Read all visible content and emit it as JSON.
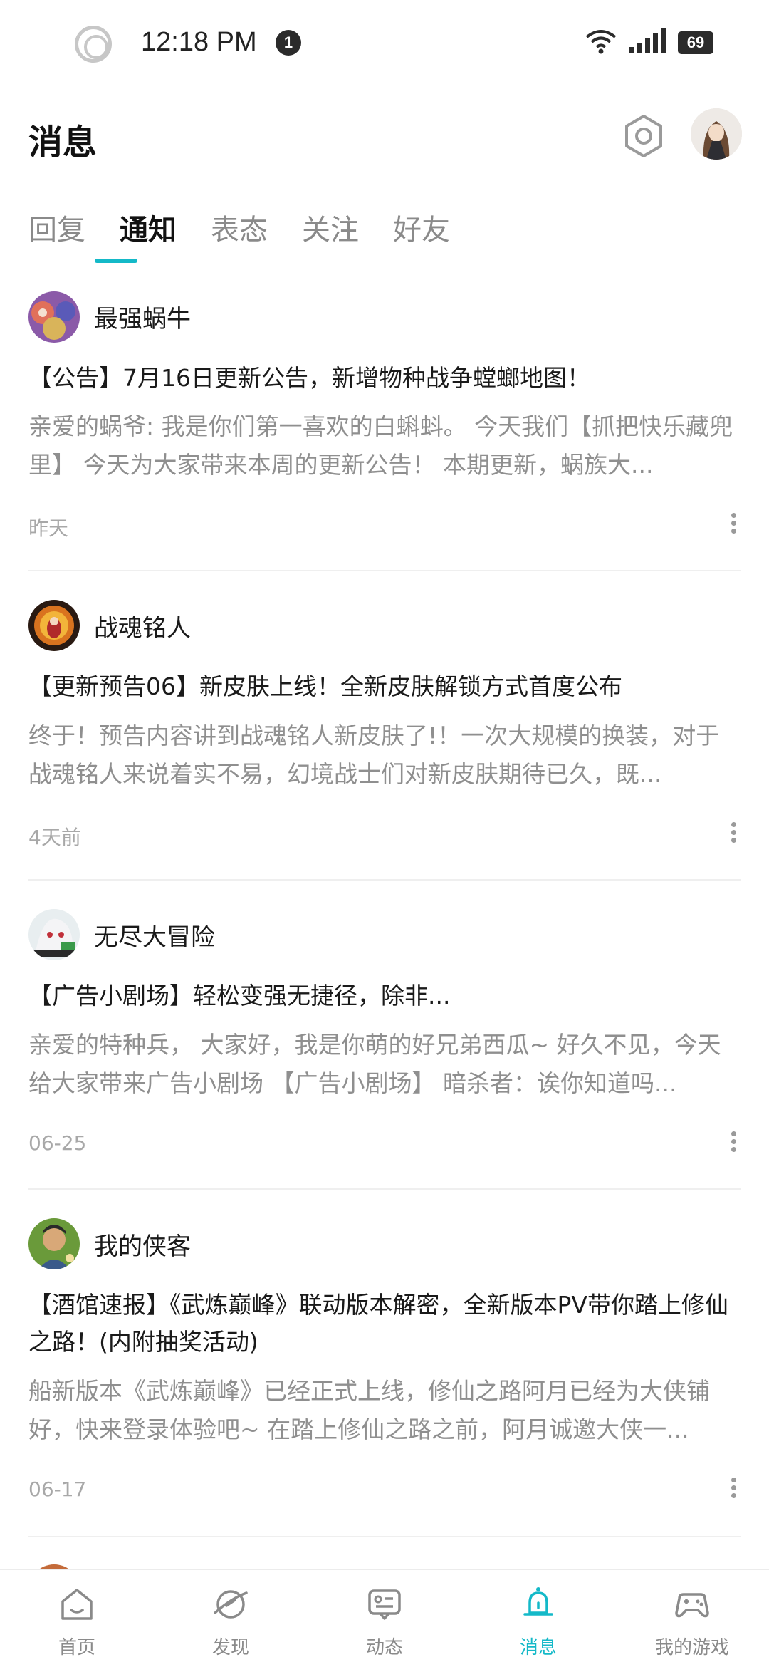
{
  "status_bar": {
    "time": "12:18 PM",
    "notification_count": "1",
    "battery": "69"
  },
  "header": {
    "title": "消息"
  },
  "tabs": [
    {
      "label": "回复"
    },
    {
      "label": "通知"
    },
    {
      "label": "表态"
    },
    {
      "label": "关注"
    },
    {
      "label": "好友"
    }
  ],
  "active_tab": "通知",
  "posts": [
    {
      "author": "最强蜗牛",
      "title": "【公告】7月16日更新公告，新增物种战争螳螂地图！",
      "excerpt": "亲爱的蜗爷: 我是你们第一喜欢的白蝌蚪。 今天我们【抓把快乐藏兜里】 今天为大家带来本周的更新公告！ 本期更新，蜗族大...",
      "time": "昨天"
    },
    {
      "author": "战魂铭人",
      "title": "【更新预告06】新皮肤上线！全新皮肤解锁方式首度公布",
      "excerpt": "终于！预告内容讲到战魂铭人新皮肤了!！一次大规模的换装，对于战魂铭人来说着实不易，幻境战士们对新皮肤期待已久，既...",
      "time": "4天前"
    },
    {
      "author": "无尽大冒险",
      "title": "【广告小剧场】轻松变强无捷径，除非...",
      "excerpt": "亲爱的特种兵， 大家好，我是你萌的好兄弟西瓜~ 好久不见，今天给大家带来广告小剧场 【广告小剧场】 暗杀者：诶你知道吗...",
      "time": "06-25"
    },
    {
      "author": "我的侠客",
      "title": "【酒馆速报】《武炼巅峰》联动版本解密，全新版本PV带你踏上修仙之路！(内附抽奖活动)",
      "excerpt": "船新版本《武炼巅峰》已经正式上线，修仙之路阿月已经为大侠铺好，快来登录体验吧~ 在踏上修仙之路之前，阿月诚邀大侠一...",
      "time": "06-17"
    }
  ],
  "bottom_nav": [
    {
      "label": "首页",
      "icon": "home-icon"
    },
    {
      "label": "发现",
      "icon": "discover-icon"
    },
    {
      "label": "动态",
      "icon": "feed-icon"
    },
    {
      "label": "消息",
      "icon": "bell-icon"
    },
    {
      "label": "我的游戏",
      "icon": "gamepad-icon"
    }
  ],
  "colors": {
    "accent": "#14b9c8",
    "muted_text": "#8f8f8f"
  }
}
